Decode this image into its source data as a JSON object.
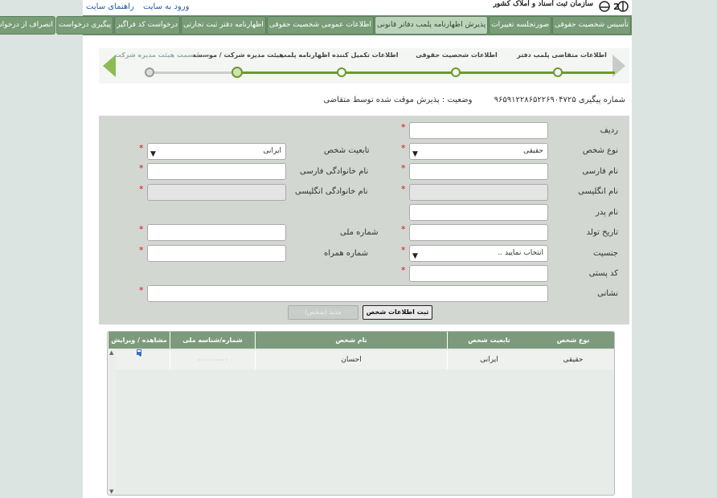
{
  "header": {
    "login_link": "ورود به سایت",
    "help_link": "راهنمای سایت",
    "brand": "سازمان ثبت اسناد و املاک کشور"
  },
  "nav": {
    "tabs": [
      {
        "label": "تأسیس شخصیت حقوقی"
      },
      {
        "label": "صورتجلسه تغییرات"
      },
      {
        "label": "پذیرش اظهارنامه پلمب دفاتر قانونی",
        "active": true
      },
      {
        "label": "اطلاعات عمومی شخصیت حقوقی"
      },
      {
        "label": "اظهارنامه دفتر ثبت تجارتی"
      },
      {
        "label": "درخواست کد فراگیر"
      },
      {
        "label": "پیگیری درخواست"
      },
      {
        "label": "انصراف از درخواست"
      }
    ]
  },
  "wizard": {
    "steps": [
      {
        "label": "اطلاعات متقاضی پلمب دفتر"
      },
      {
        "label": "اطلاعات شخصیت حقوقی"
      },
      {
        "label": "اطلاعات تکمیل کننده اظهارنامه پلمب"
      },
      {
        "label": "هیئت مدیره شرکت / موسسه",
        "current": true
      },
      {
        "label": "سمت هیئت مدیره شرکت / ..."
      }
    ]
  },
  "status": {
    "tracking_label": "شماره پیگیری",
    "tracking_number": "۹۶۵۹۱۲۲۸۶۵۲۲۶۹۰۴۷۲۵",
    "state_label": "وضعیت :",
    "state_value": "پذیرش موقت شده توسط متقاضی"
  },
  "form": {
    "row_label": "ردیف",
    "person_type_label": "نوع شخص",
    "person_type_value": "حقیقی",
    "nationality_label": "تابعیت شخص",
    "nationality_value": "ایرانی",
    "fname_fa_label": "نام فارسی",
    "lname_fa_label": "نام خانوادگی فارسی",
    "fname_en_label": "نام انگلیسی",
    "lname_en_label": "نام خانوادگی انگلیسی",
    "father_label": "نام پدر",
    "birth_label": "تاریخ تولد",
    "national_id_label": "شماره ملی",
    "gender_label": "جنسیت",
    "gender_value": "انتخاب نمایید ..",
    "mobile_label": "شماره همراه",
    "postal_label": "کد پستی",
    "address_label": "نشانی",
    "save_button": "ثبت اطلاعات شخص",
    "new_button": "جدید (شخص)"
  },
  "grid": {
    "headers": [
      "نوع شخص",
      "تابعیت شخص",
      "نام شخص",
      "شماره/شناسه ملی",
      "مشاهده / ویرایش"
    ],
    "rows": [
      {
        "type": "حقیقی",
        "nationality": "ایرانی",
        "name": "احسان",
        "national_id": "۰۰۰۰۰۰۰۰۰۰"
      }
    ]
  },
  "colors": {
    "nav_bg": "#789d77",
    "nav_active": "#bcd3bb",
    "wizard_green": "#6b9a29",
    "required": "#dd1111"
  }
}
